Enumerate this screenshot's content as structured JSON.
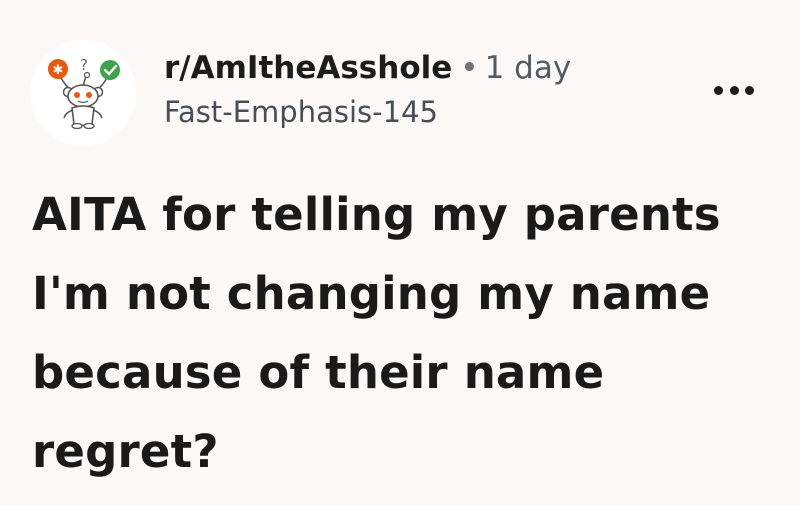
{
  "post": {
    "subreddit": "r/AmItheAsshole",
    "separator": "•",
    "age": "1 day",
    "author": "Fast-Emphasis-145",
    "title": "AITA for telling my parents I'm not changing my name because of their name regret?"
  },
  "icons": {
    "avatar": "snoo-avatar-icon",
    "more": "more-options-icon"
  },
  "colors": {
    "background": "#faf9f8",
    "text": "#1a1a1b",
    "avatar_orange": "#e8590c",
    "avatar_green": "#3fa34d"
  }
}
